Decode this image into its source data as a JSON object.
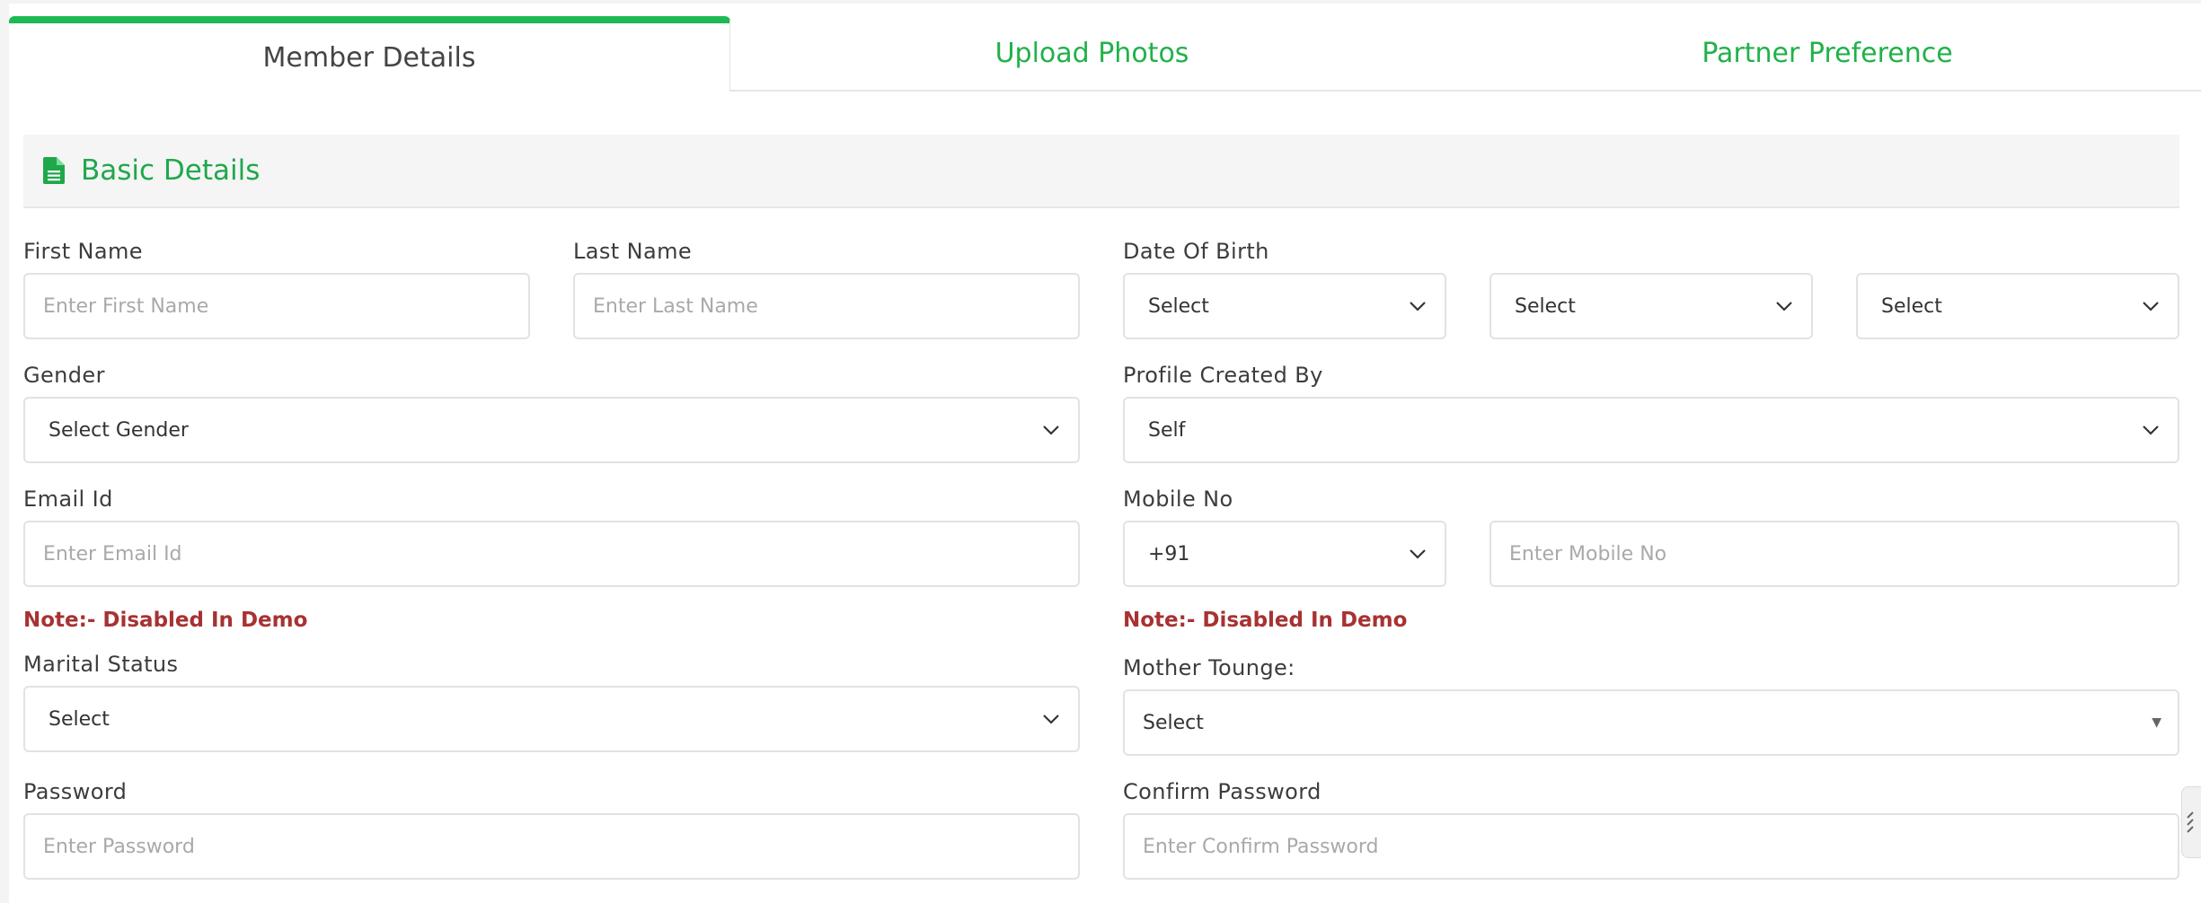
{
  "tabs": [
    {
      "label": "Member Details",
      "active": true
    },
    {
      "label": "Upload Photos",
      "active": false
    },
    {
      "label": "Partner Preference",
      "active": false
    }
  ],
  "section": {
    "title": "Basic Details",
    "icon": "document-icon"
  },
  "colors": {
    "accent": "#1db954",
    "accent_text": "#21b14a",
    "note": "#a83232"
  },
  "form": {
    "first_name": {
      "label": "First Name",
      "placeholder": "Enter First Name"
    },
    "last_name": {
      "label": "Last Name",
      "placeholder": "Enter Last Name"
    },
    "dob": {
      "label": "Date Of Birth",
      "day": "Select",
      "month": "Select",
      "year": "Select"
    },
    "gender": {
      "label": "Gender",
      "value": "Select Gender"
    },
    "profile_created_by": {
      "label": "Profile Created By",
      "value": "Self"
    },
    "email": {
      "label": "Email Id",
      "placeholder": "Enter Email Id",
      "note": "Note:- Disabled In Demo"
    },
    "mobile": {
      "label": "Mobile No",
      "code": "+91",
      "placeholder": "Enter Mobile No",
      "note": "Note:- Disabled In Demo"
    },
    "marital_status": {
      "label": "Marital Status",
      "value": "Select"
    },
    "mother_tongue": {
      "label": "Mother Tounge:",
      "value": "Select"
    },
    "password": {
      "label": "Password",
      "placeholder": "Enter Password"
    },
    "confirm_password": {
      "label": "Confirm Password",
      "placeholder": "Enter Confirm Password"
    }
  }
}
